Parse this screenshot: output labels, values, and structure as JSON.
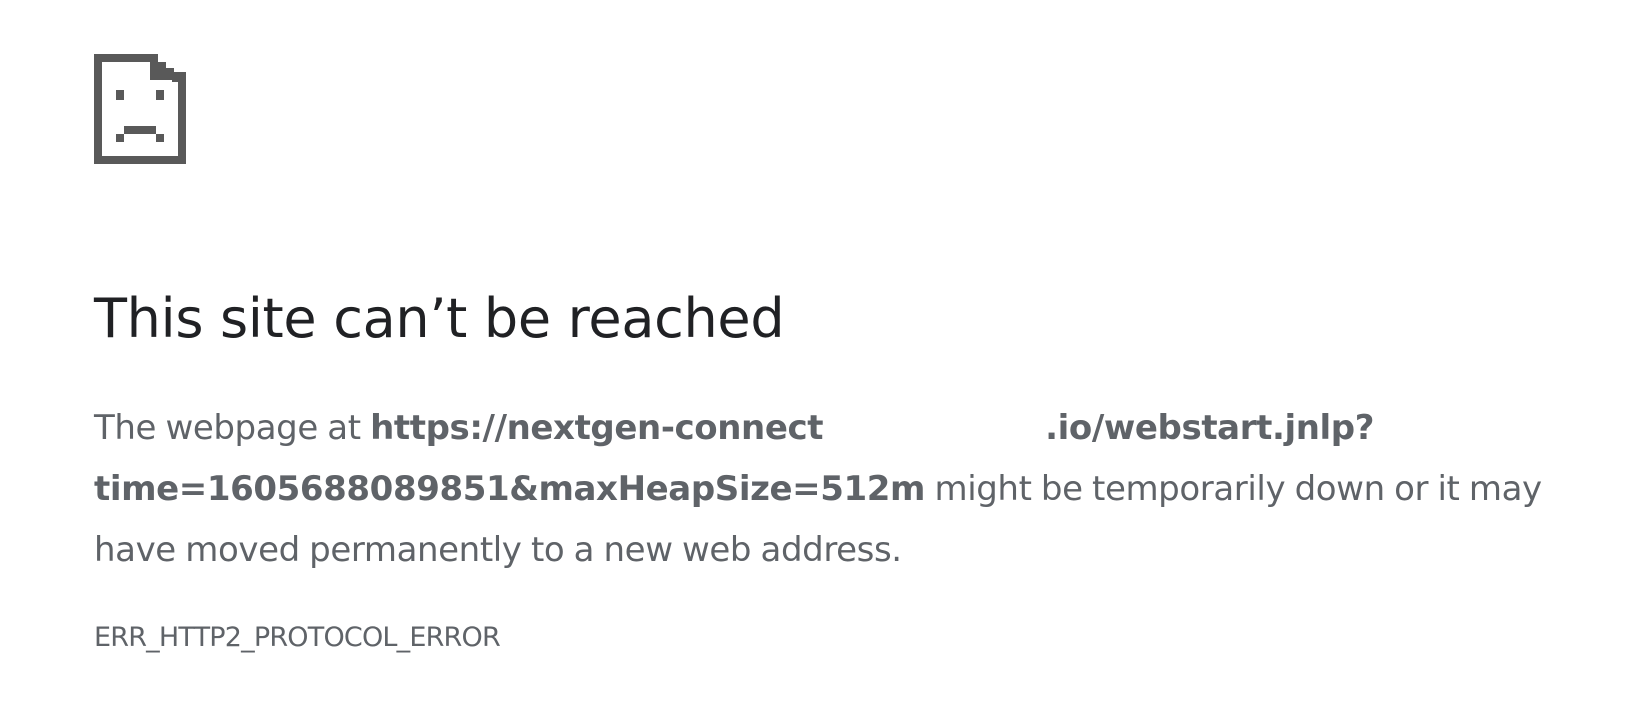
{
  "icon": "sad-page-icon",
  "colors": {
    "icon": "#595959",
    "title": "#202124",
    "text": "#5f6368",
    "background": "#ffffff"
  },
  "error": {
    "title": "This site can’t be reached",
    "message_prefix": "The webpage at ",
    "url_start": "https://nextgen-connect",
    "url_end": ".io/webstart.jnlp?",
    "url_query": "time=1605688089851&maxHeapSize=512m",
    "message_suffix": " might be temporarily down or it may have moved permanently to a new web address.",
    "code": "ERR_HTTP2_PROTOCOL_ERROR"
  }
}
